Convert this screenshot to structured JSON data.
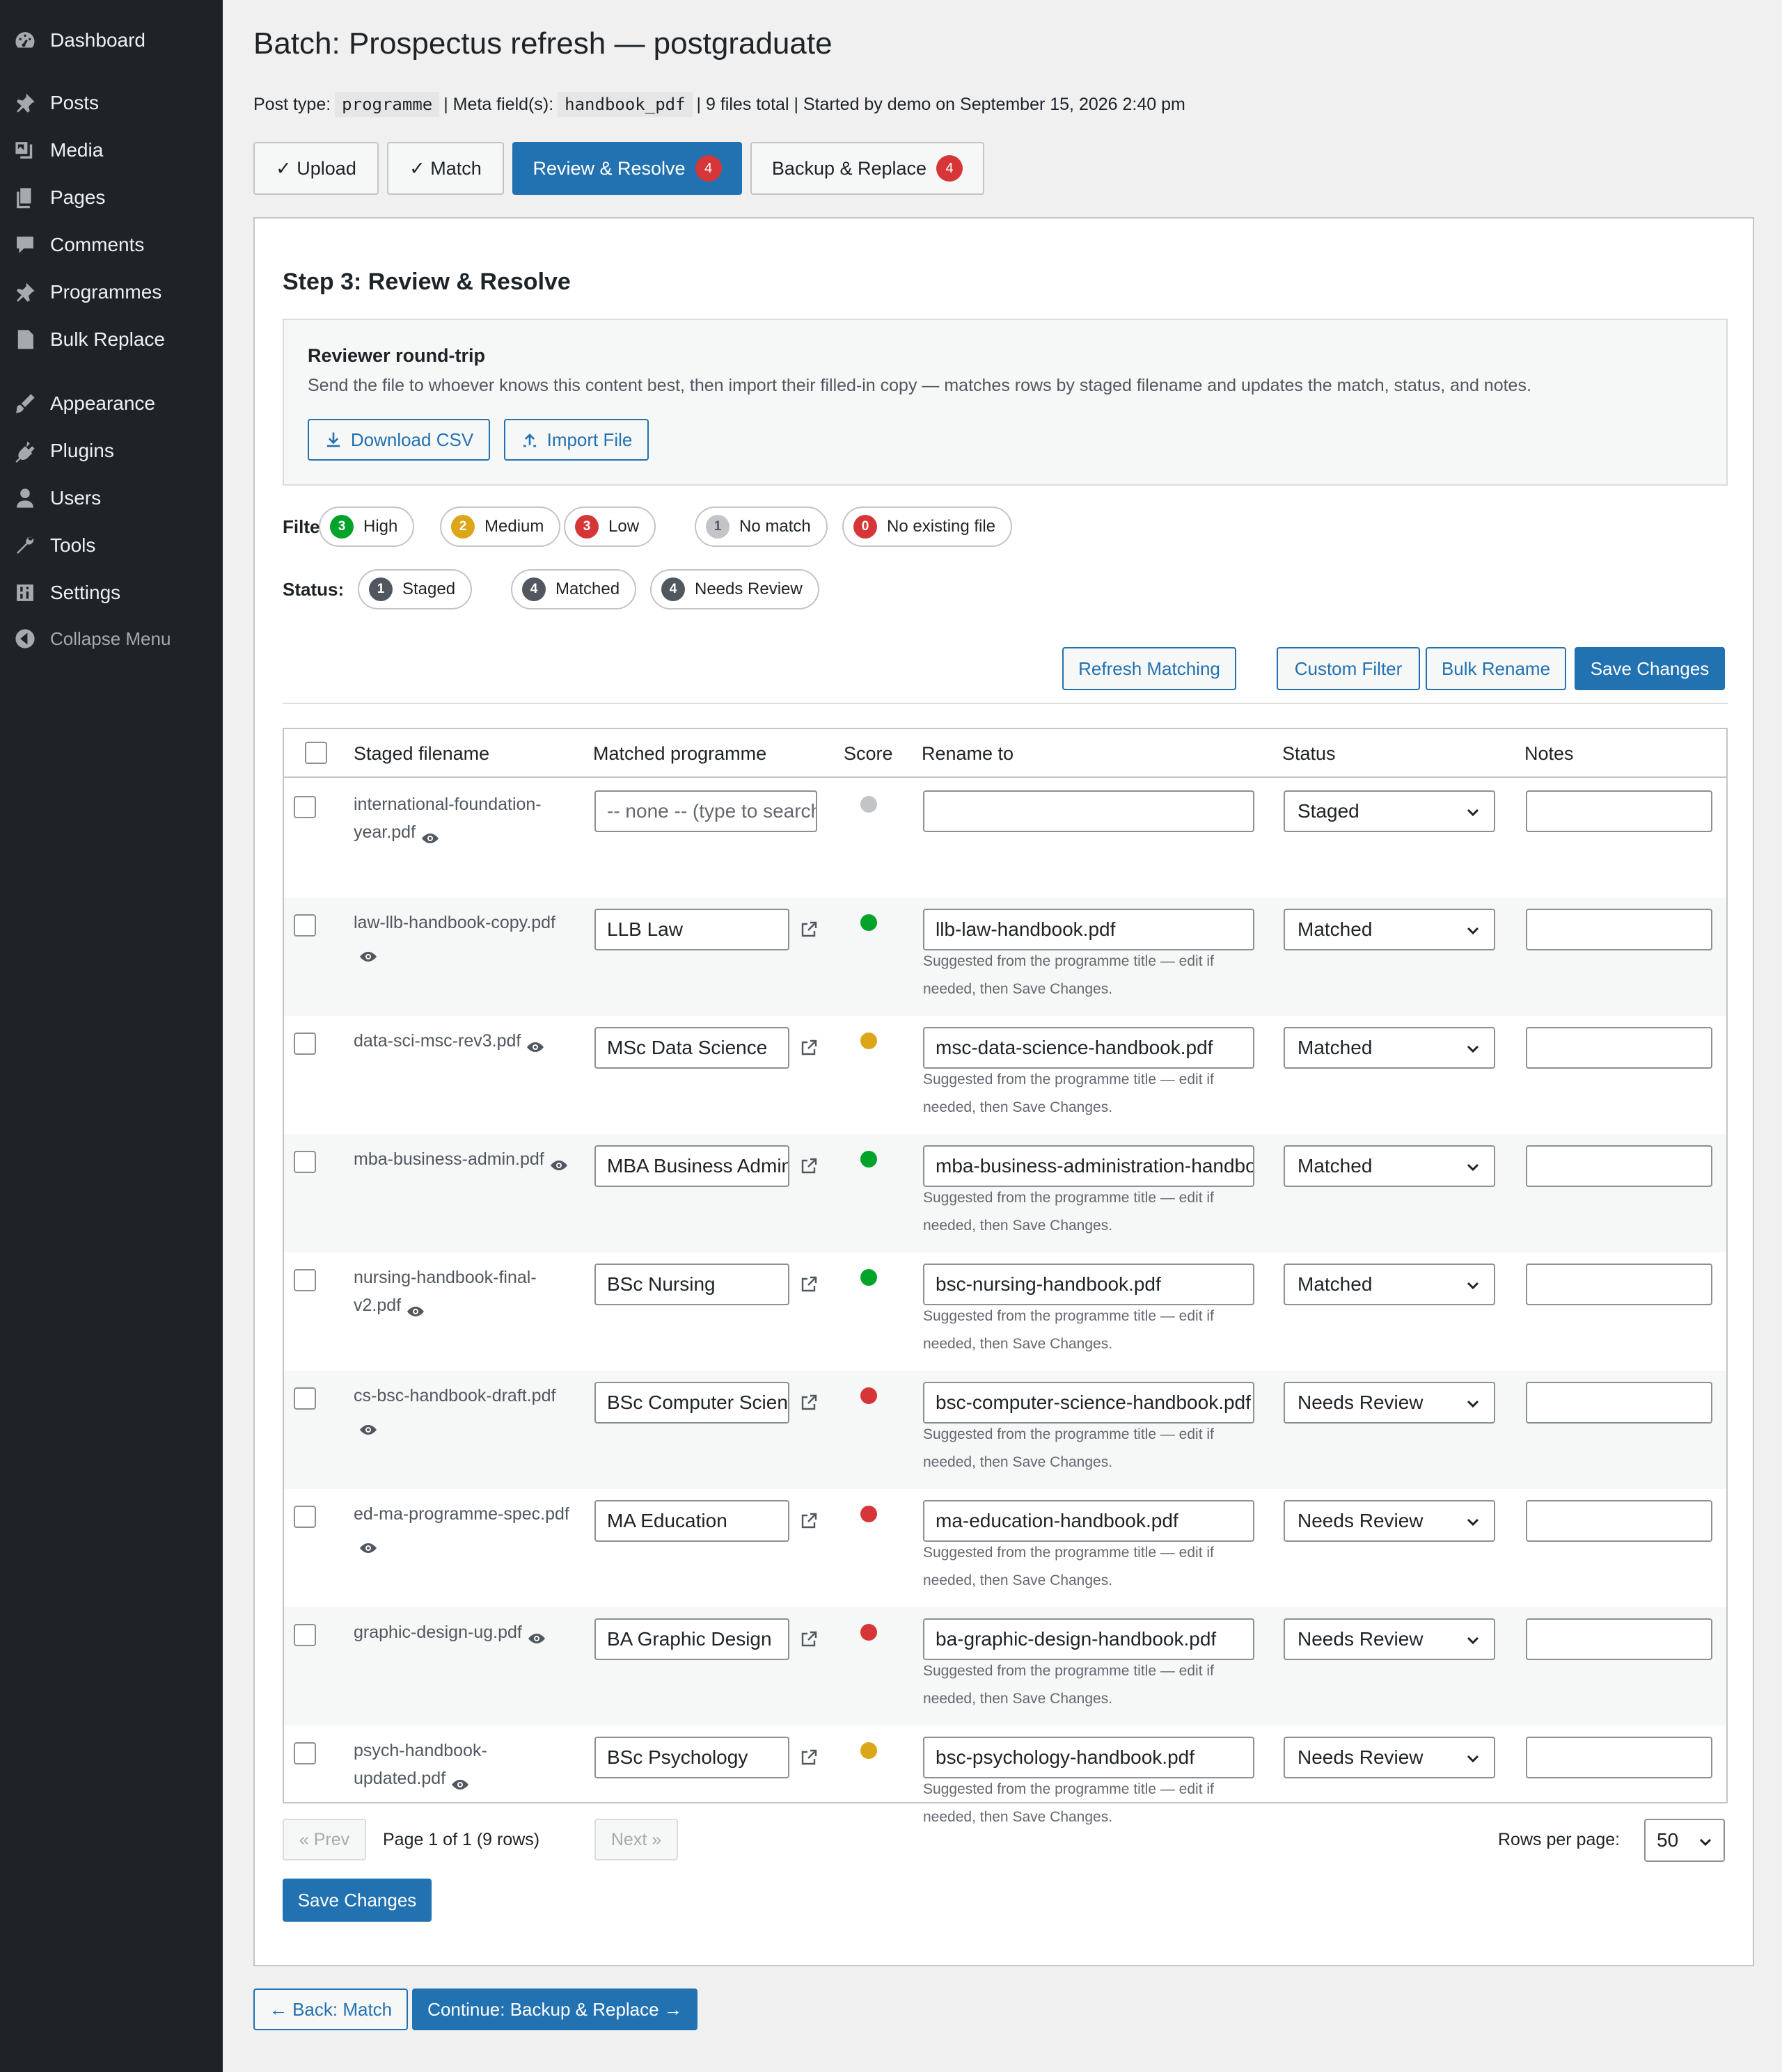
{
  "sidebar": {
    "items": [
      {
        "label": "Dashboard",
        "icon": "dashboard-icon"
      },
      {
        "label": "Posts",
        "icon": "pin-icon"
      },
      {
        "label": "Media",
        "icon": "media-icon"
      },
      {
        "label": "Pages",
        "icon": "pages-icon"
      },
      {
        "label": "Comments",
        "icon": "comment-icon"
      },
      {
        "label": "Programmes",
        "icon": "pin-icon"
      },
      {
        "label": "Bulk Replace",
        "icon": "document-icon"
      },
      {
        "label": "Appearance",
        "icon": "brush-icon"
      },
      {
        "label": "Plugins",
        "icon": "plugin-icon"
      },
      {
        "label": "Users",
        "icon": "user-icon"
      },
      {
        "label": "Tools",
        "icon": "wrench-icon"
      },
      {
        "label": "Settings",
        "icon": "settings-icon"
      }
    ],
    "collapse_label": "Collapse Menu"
  },
  "page": {
    "title": "Batch: Prospectus refresh — postgraduate",
    "meta": {
      "post_type_label": "Post type:",
      "post_type": "programme",
      "meta_field_label": "| Meta field(s):",
      "meta_field": "handbook_pdf",
      "summary": "| 9 files total | Started by demo on September 15, 2026 2:40 pm"
    }
  },
  "tabs": [
    {
      "label": "✓ Upload"
    },
    {
      "label": "✓ Match"
    },
    {
      "label": "Review & Resolve",
      "badge": "4"
    },
    {
      "label": "Backup & Replace",
      "badge": "4"
    }
  ],
  "step": {
    "title": "Step 3: Review & Resolve",
    "roundtrip": {
      "title": "Reviewer round-trip",
      "description": "Send the file to whoever knows this content best, then import their filled-in copy — matches rows by staged filename and updates the match, status, and notes.",
      "download_label": "Download CSV",
      "import_label": "Import File"
    },
    "filter": {
      "label": "Filter:",
      "items": [
        {
          "count": "3",
          "label": "High"
        },
        {
          "count": "2",
          "label": "Medium"
        },
        {
          "count": "3",
          "label": "Low"
        },
        {
          "count": "1",
          "label": "No match"
        },
        {
          "count": "0",
          "label": "No existing file"
        }
      ]
    },
    "status_filter": {
      "label": "Status:",
      "items": [
        {
          "count": "1",
          "label": "Staged"
        },
        {
          "count": "4",
          "label": "Matched"
        },
        {
          "count": "4",
          "label": "Needs Review"
        }
      ]
    },
    "actions": {
      "refresh": "Refresh Matching",
      "custom_filter": "Custom Filter",
      "bulk_rename": "Bulk Rename",
      "save": "Save Changes"
    }
  },
  "colors": {
    "high": "#00a32a",
    "medium": "#dba617",
    "low": "#d63638",
    "none": "#c3c4c7",
    "accent": "#2271b1",
    "neutral_badge": "#50575e"
  },
  "table": {
    "columns": [
      "Staged filename",
      "Matched programme",
      "Score",
      "Rename to",
      "Status",
      "Notes"
    ],
    "hint": "Suggested from the programme title — edit if needed, then Save Changes.",
    "rows": [
      {
        "file": "international-foundation-year.pdf",
        "programme": "",
        "programme_placeholder": "-- none -- (type to search)",
        "score": "none",
        "rename": "",
        "status": "Staged",
        "notes": ""
      },
      {
        "file": "law-llb-handbook-copy.pdf",
        "programme": "LLB Law",
        "score": "high",
        "rename": "llb-law-handbook.pdf",
        "status": "Matched",
        "notes": ""
      },
      {
        "file": "data-sci-msc-rev3.pdf",
        "programme": "MSc Data Science",
        "score": "medium",
        "rename": "msc-data-science-handbook.pdf",
        "status": "Matched",
        "notes": ""
      },
      {
        "file": "mba-business-admin.pdf",
        "programme": "MBA Business Administration",
        "score": "high",
        "rename": "mba-business-administration-handbook.pdf",
        "status": "Matched",
        "notes": ""
      },
      {
        "file": "nursing-handbook-final-v2.pdf",
        "programme": "BSc Nursing",
        "score": "high",
        "rename": "bsc-nursing-handbook.pdf",
        "status": "Matched",
        "notes": ""
      },
      {
        "file": "cs-bsc-handbook-draft.pdf",
        "programme": "BSc Computer Science",
        "score": "low",
        "rename": "bsc-computer-science-handbook.pdf",
        "status": "Needs Review",
        "notes": ""
      },
      {
        "file": "ed-ma-programme-spec.pdf",
        "programme": "MA Education",
        "score": "low",
        "rename": "ma-education-handbook.pdf",
        "status": "Needs Review",
        "notes": ""
      },
      {
        "file": "graphic-design-ug.pdf",
        "programme": "BA Graphic Design",
        "score": "low",
        "rename": "ba-graphic-design-handbook.pdf",
        "status": "Needs Review",
        "notes": ""
      },
      {
        "file": "psych-handbook-updated.pdf",
        "programme": "BSc Psychology",
        "score": "medium",
        "rename": "bsc-psychology-handbook.pdf",
        "status": "Needs Review",
        "notes": ""
      }
    ]
  },
  "pagination": {
    "prev": "« Prev",
    "info": "Page 1 of 1 (9 rows)",
    "next": "Next »",
    "rows_per_page_label": "Rows per page:",
    "rows_per_page": "50"
  },
  "footer": {
    "save": "Save Changes",
    "back": "← Back: Match",
    "continue": "Continue: Backup & Replace →"
  }
}
